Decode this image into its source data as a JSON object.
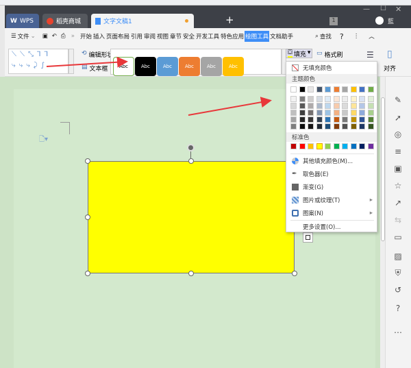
{
  "tabs": [
    {
      "label": "WPS"
    },
    {
      "label": "稻壳商城"
    },
    {
      "label": "文字文稿1"
    }
  ],
  "titlebar": {
    "page_badge": "1",
    "avatar_text": "藍"
  },
  "menu": {
    "file": "文件",
    "items": [
      "开始",
      "插入",
      "页面布局",
      "引用",
      "审阅",
      "视图",
      "章节",
      "安全",
      "开发工具",
      "特色应用",
      "绘图工具",
      "文档助手"
    ],
    "active": "绘图工具",
    "search": "查找",
    "help": "?"
  },
  "ribbon": {
    "edit_shape": "编辑形状",
    "text_box": "文本框",
    "fill": "填充",
    "format_painter": "格式刷",
    "align": "对齐",
    "styles": [
      {
        "label": "Abc",
        "bg": "#ffffff",
        "fg": "#000",
        "border": "#70ad47"
      },
      {
        "label": "Abc",
        "bg": "#000000",
        "fg": "#fff",
        "border": "#000"
      },
      {
        "label": "Abc",
        "bg": "#5b9bd5",
        "fg": "#fff",
        "border": "#5b9bd5"
      },
      {
        "label": "Abc",
        "bg": "#ed7d31",
        "fg": "#fff",
        "border": "#ed7d31"
      },
      {
        "label": "Abc",
        "bg": "#a5a5a5",
        "fg": "#fff",
        "border": "#a5a5a5"
      },
      {
        "label": "Abc",
        "bg": "#ffc000",
        "fg": "#fff",
        "border": "#ffc000"
      }
    ]
  },
  "fill_menu": {
    "no_fill": "无填充颜色",
    "theme_title": "主题颜色",
    "standard_title": "标准色",
    "theme": [
      "#ffffff",
      "#000000",
      "#e7e6e6",
      "#44546a",
      "#5b9bd5",
      "#ed7d31",
      "#a5a5a5",
      "#ffc000",
      "#4472c4",
      "#70ad47"
    ],
    "shades": [
      [
        "#f2f2f2",
        "#7f7f7f",
        "#d0cece",
        "#d6dce4",
        "#deebf6",
        "#fbe5d5",
        "#ededed",
        "#fff2cc",
        "#d9e2f3",
        "#e2efd9"
      ],
      [
        "#d8d8d8",
        "#595959",
        "#aeabab",
        "#adb9ca",
        "#bdd7ee",
        "#f7cbac",
        "#dbdbdb",
        "#fee599",
        "#b4c6e7",
        "#c5e0b3"
      ],
      [
        "#bfbfbf",
        "#3f3f3f",
        "#757070",
        "#8496b0",
        "#9cc3e5",
        "#f4b183",
        "#c9c9c9",
        "#ffd965",
        "#8eaadb",
        "#a8d08d"
      ],
      [
        "#a5a5a5",
        "#262626",
        "#3a3838",
        "#323f4f",
        "#2e75b5",
        "#c55a11",
        "#7b7b7b",
        "#bf9000",
        "#2f5496",
        "#538135"
      ],
      [
        "#7f7f7f",
        "#0c0c0c",
        "#171616",
        "#222a35",
        "#1e4e79",
        "#833c0b",
        "#525252",
        "#7f6000",
        "#1f3864",
        "#375623"
      ]
    ],
    "standard": [
      "#c00000",
      "#ff0000",
      "#ffc000",
      "#ffff00",
      "#92d050",
      "#00b050",
      "#00b0f0",
      "#0070c0",
      "#002060",
      "#7030a0"
    ],
    "selected_standard": "#ffff00",
    "more_colors": "其他填充颜色(M)...",
    "eyedropper": "取色器(E)",
    "gradient": "渐变(G)",
    "picture": "图片或纹理(T)",
    "pattern": "图案(N)",
    "more_settings": "更多设置(O)..."
  },
  "shape": {
    "fill": "#ffff00"
  },
  "colors": {
    "accent": "#3e8ef7",
    "arrow": "#e8373a"
  }
}
